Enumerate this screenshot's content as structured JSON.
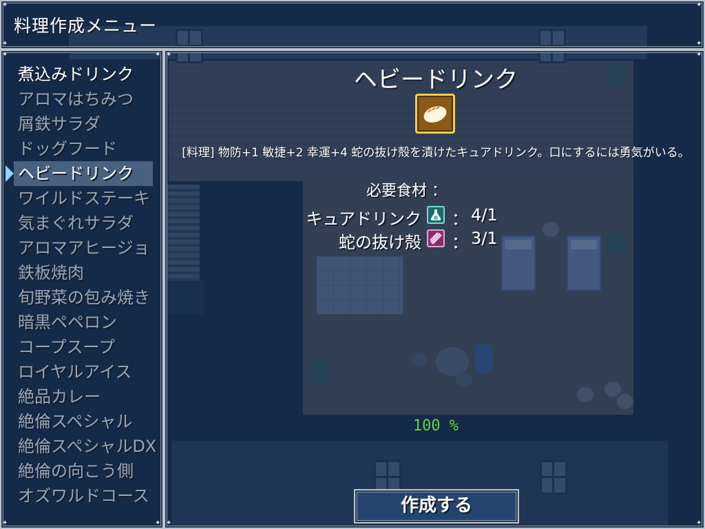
{
  "window_title": "料理作成メニュー",
  "recipes": [
    {
      "name": "煮込みドリンク",
      "available": true
    },
    {
      "name": "アロマはちみつ",
      "available": false
    },
    {
      "name": "屑鉄サラダ",
      "available": false
    },
    {
      "name": "ドッグフード",
      "available": false
    },
    {
      "name": "ヘビードリンク",
      "available": true,
      "selected": true
    },
    {
      "name": "ワイルドステーキ",
      "available": false
    },
    {
      "name": "気まぐれサラダ",
      "available": false
    },
    {
      "name": "アロマアヒージョ",
      "available": false
    },
    {
      "name": "鉄板焼肉",
      "available": false
    },
    {
      "name": "旬野菜の包み焼き",
      "available": false
    },
    {
      "name": "暗黒ペペロン",
      "available": false
    },
    {
      "name": "コープスープ",
      "available": false
    },
    {
      "name": "ロイヤルアイス",
      "available": false
    },
    {
      "name": "絶品カレー",
      "available": false
    },
    {
      "name": "絶倫スペシャル",
      "available": false
    },
    {
      "name": "絶倫スペシャルDX",
      "available": false
    },
    {
      "name": "絶倫の向こう側",
      "available": false
    },
    {
      "name": "オズワルドコース",
      "available": false
    }
  ],
  "detail": {
    "name": "ヘビードリンク",
    "icon": "bread-icon",
    "description": "[料理] 物防+1 敏捷+2 幸運+4 蛇の抜け殻を漬けたキュアドリンク。口にするには勇気がいる。",
    "ingredients_label": "必要食材 ：",
    "ingredients": [
      {
        "name": "キュアドリンク",
        "icon": "potion-icon",
        "owned": 4,
        "required": 1,
        "count_text": "4/1"
      },
      {
        "name": "蛇の抜け殻",
        "icon": "snake-skin-icon",
        "owned": 3,
        "required": 1,
        "count_text": "3/1"
      }
    ],
    "colon": "：",
    "success_rate": "100 %",
    "create_label": "作成する"
  },
  "colors": {
    "window_bg": "#1c3860",
    "text_enabled": "#ffffff",
    "text_disabled": "#9aa4b5",
    "success_green": "#6bd45a",
    "cursor": "#8fd3ff"
  }
}
